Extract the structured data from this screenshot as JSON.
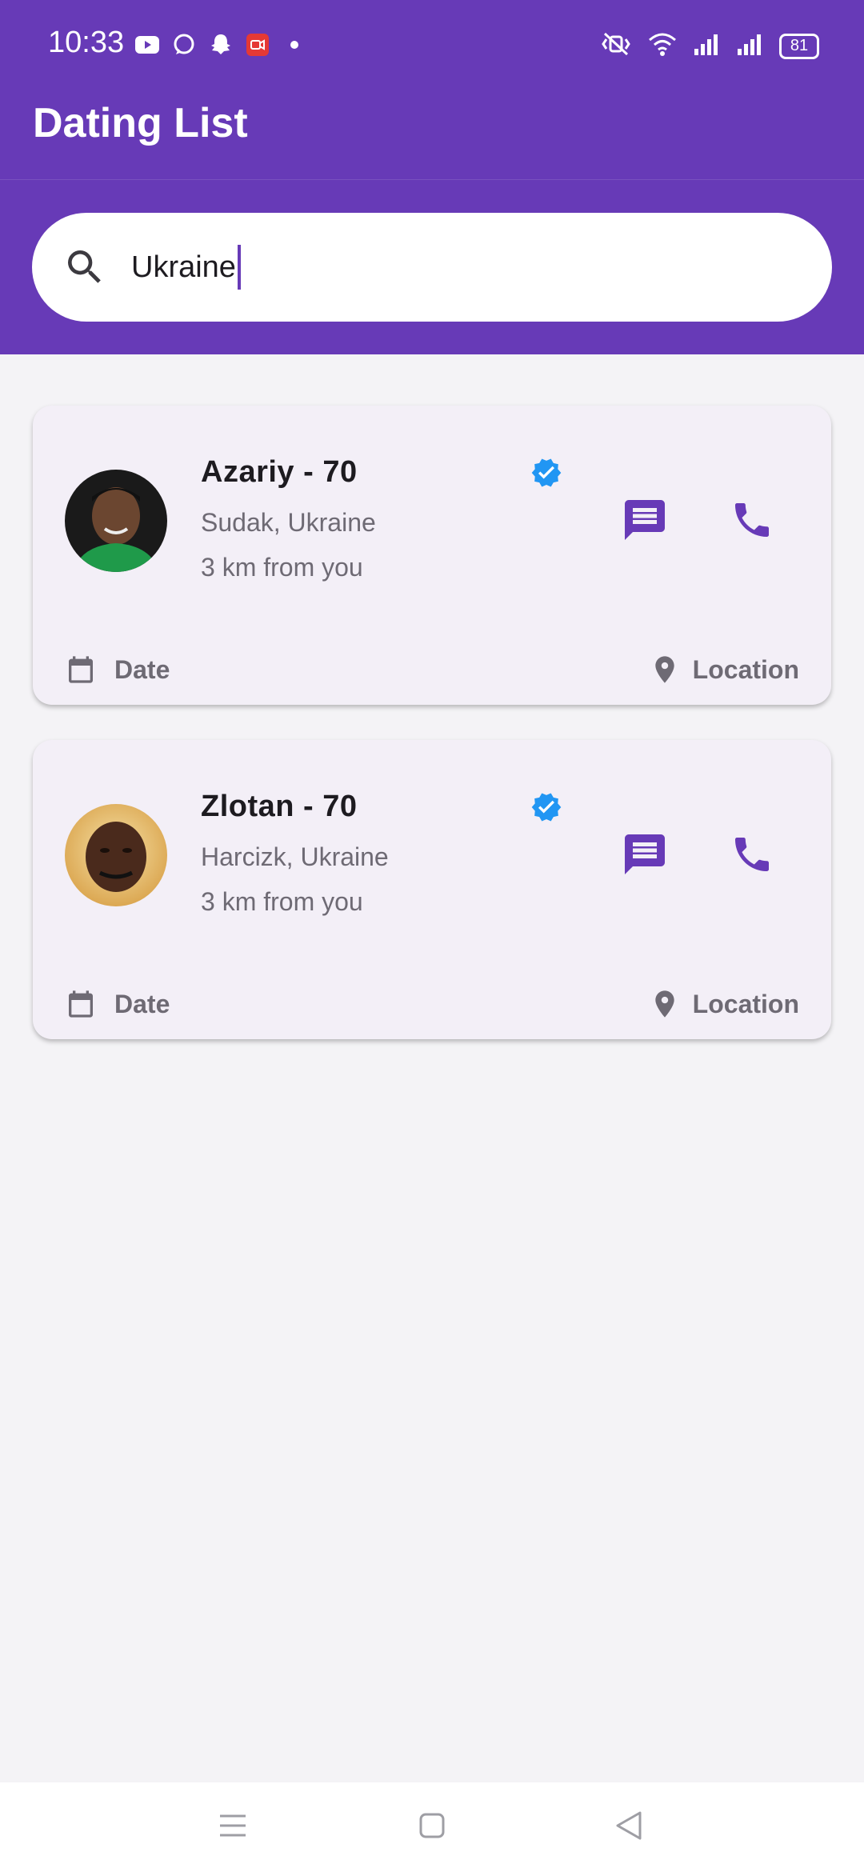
{
  "status_bar": {
    "time": "10:33",
    "battery": "81",
    "left_icons": [
      "youtube-icon",
      "whatsapp-icon",
      "snapchat-icon",
      "screen-recorder-icon",
      "dot-icon"
    ],
    "right_icons": [
      "mute-vibrate-icon",
      "wifi-icon",
      "signal-icon",
      "signal-icon-2",
      "battery-icon"
    ]
  },
  "app_bar": {
    "title": "Dating List"
  },
  "search": {
    "value": "Ukraine",
    "icon": "search-icon"
  },
  "colors": {
    "primary": "#673ab7",
    "card": "#f3eff7",
    "verified": "#2196f3",
    "action": "#673ab7"
  },
  "profiles": [
    {
      "name": "Azariy - 70",
      "location": "Sudak, Ukraine",
      "distance": "3 km from you",
      "date_label": "Date",
      "location_label": "Location"
    },
    {
      "name": "Zlotan - 70",
      "location": "Harcizk, Ukraine",
      "distance": "3 km from you",
      "date_label": "Date",
      "location_label": "Location"
    }
  ],
  "nav_bar": {
    "icons": [
      "menu-icon",
      "home-icon",
      "back-icon"
    ]
  }
}
